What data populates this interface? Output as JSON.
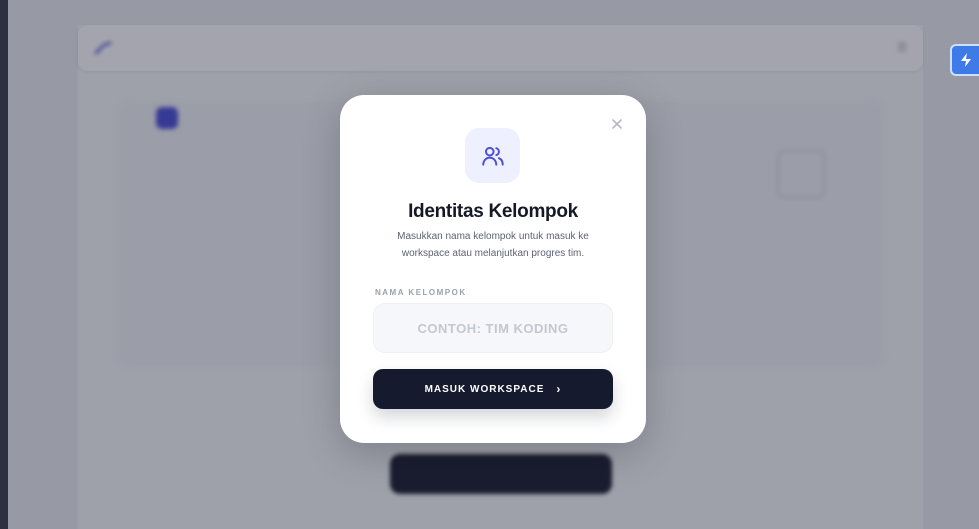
{
  "modal": {
    "title": "Identitas Kelompok",
    "description": "Masukkan nama kelompok untuk masuk ke workspace atau melanjutkan progres tim.",
    "field_label": "NAMA KELOMPOK",
    "input_placeholder": "CONTOH: TIM KODING",
    "input_value": "",
    "submit_label": "MASUK WORKSPACE",
    "submit_icon": "chevron-right-icon",
    "header_icon": "users-icon",
    "close_icon": "close-icon"
  },
  "colors": {
    "accent": "#4c4fd6",
    "button_dark": "#151a2e",
    "icon_bg": "#eef0ff",
    "side_tool": "#3f7be8"
  }
}
